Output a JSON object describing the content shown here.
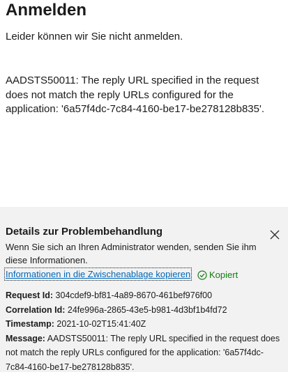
{
  "header": {
    "title": "Anmelden",
    "subtitle": "Leider können wir Sie nicht anmelden."
  },
  "error": {
    "message": "AADSTS50011: The reply URL specified in the request does not match the reply URLs configured for the application: '6a57f4dc-7c84-4160-be17-be278128b835'."
  },
  "details": {
    "title": "Details zur Problembehandlung",
    "hint": "Wenn Sie sich an Ihren Administrator wenden, senden Sie ihm diese Informationen.",
    "copy_link": "Informationen in die Zwischenablage kopieren",
    "copied_label": "Kopiert",
    "request_id_label": "Request Id:",
    "request_id": "304cdef9-bf81-4a89-8670-461bef976f00",
    "correlation_id_label": "Correlation Id:",
    "correlation_id": "24fe996a-2865-43e5-b981-4d3bf1b4fd72",
    "timestamp_label": "Timestamp:",
    "timestamp": "2021-10-02T15:41:40Z",
    "message_label": "Message:",
    "message": "AADSTS50011: The reply URL specified in the request does not match the reply URLs configured for the application: '6a57f4dc-7c84-4160-be17-be278128b835'."
  },
  "colors": {
    "link": "#0067b8",
    "success": "#107c10",
    "panel_bg": "#f2f2f2"
  },
  "icons": {
    "close": "close-icon",
    "copied": "checkmark-circle-icon"
  }
}
